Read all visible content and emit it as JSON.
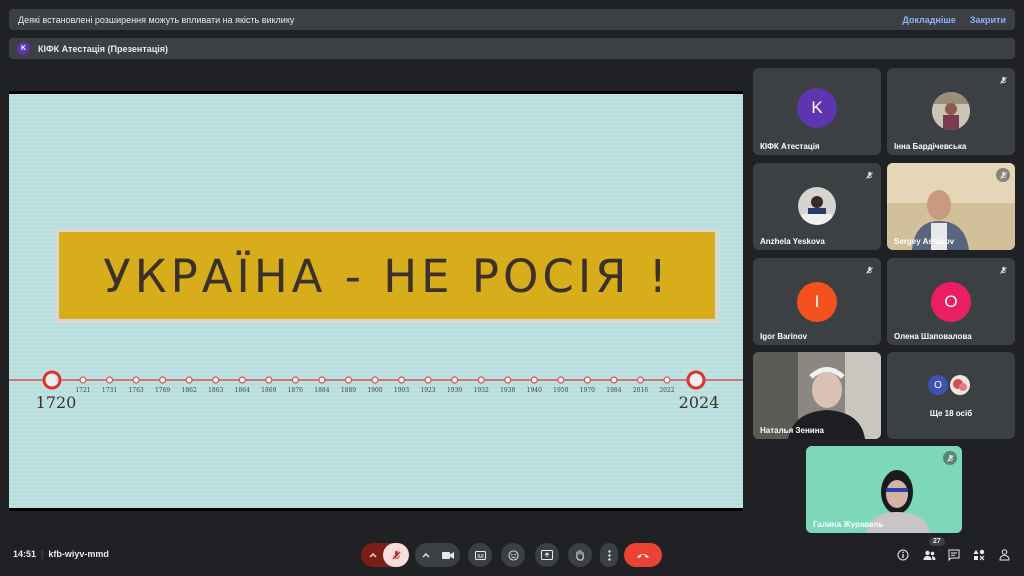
{
  "banner": {
    "message": "Деякі встановлені розширення можуть впливати на якість виклику",
    "details": "Докладніше",
    "close": "Закрити"
  },
  "presentation": {
    "initial": "K",
    "title": "КІФК Атестація (Презентація)"
  },
  "slide": {
    "headline": "УКРАЇНА - НЕ РОСІЯ !",
    "start_year": "1720",
    "end_year": "2024",
    "timeline_years": [
      "1721",
      "1731",
      "1763",
      "1769",
      "1862",
      "1863",
      "1864",
      "1869",
      "1876",
      "1884",
      "1889",
      "1900",
      "1903",
      "1923",
      "1930",
      "1932",
      "1938",
      "1940",
      "1950",
      "1970",
      "1984",
      "2016",
      "2022"
    ]
  },
  "participants": [
    {
      "name": "КІФК Атестація",
      "initial": "K",
      "color": "#5e35b1",
      "muted": false
    },
    {
      "name": "Інна Бардічевська",
      "muted": true
    },
    {
      "name": "Anzhela Yeskova",
      "muted": true
    },
    {
      "name": "Sergey Astapov",
      "muted": true
    },
    {
      "name": "Igor Barinov",
      "initial": "I",
      "color": "#f4511e",
      "muted": true
    },
    {
      "name": "Олена Шаповалова",
      "initial": "О",
      "color": "#e91e63",
      "muted": true
    },
    {
      "name": "Наталья Зенина",
      "muted": false
    },
    {
      "more_label": "Ще 18 осіб",
      "initial": "О",
      "color": "#3f51b5"
    },
    {
      "name": "Галина Журавель",
      "muted": true
    }
  ],
  "bottom": {
    "time": "14:51",
    "meeting_code": "kfb-wiyv-mmd",
    "participant_count": "27"
  },
  "colors": {
    "accent_red": "#ea4335",
    "mic_off_bg": "#f9dedc",
    "slide_bg": "#b9e0df",
    "banner_yellow": "#d8ad1c"
  }
}
